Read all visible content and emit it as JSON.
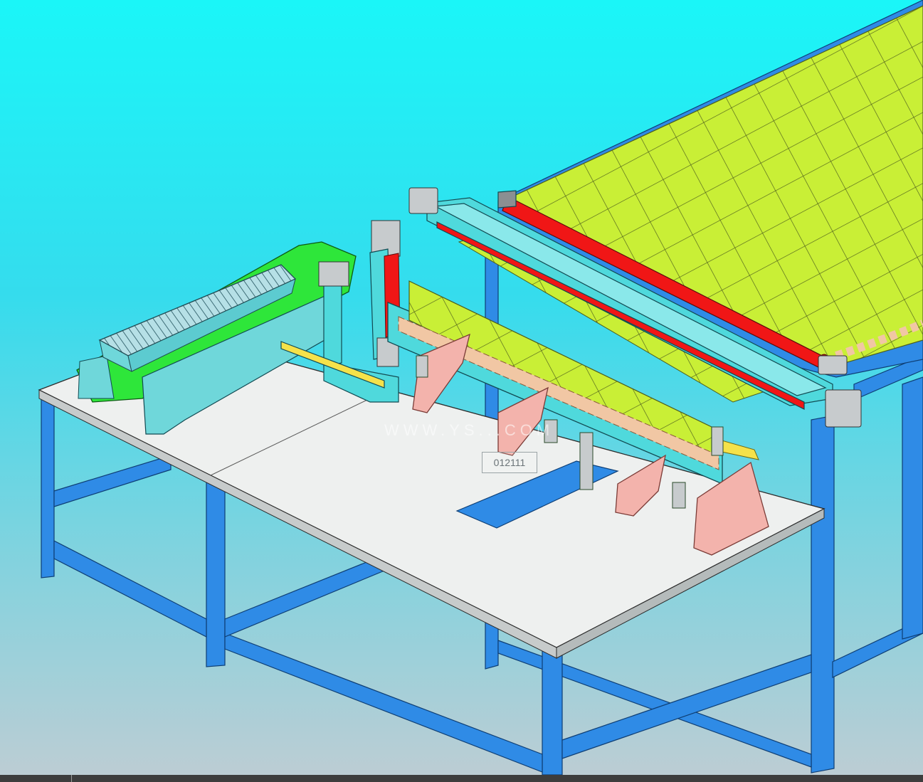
{
  "viewport": {
    "background_top": "#1af6f8",
    "background_bottom": "#bccdd4",
    "watermark_text": "WWW.YS...COM",
    "part_id_label": "012111"
  },
  "colors": {
    "frame_blue": "#2f8be6",
    "tabletop": "#eef0ef",
    "conveyor_green": "#2ee63a",
    "panel_yellow_green": "#c5ee2e",
    "cyan_rail": "#4fd9dc",
    "red_roller": "#f01616",
    "pink_stand": "#f3b3ac",
    "roller_tan": "#f1c7a4"
  },
  "statusbar": {}
}
